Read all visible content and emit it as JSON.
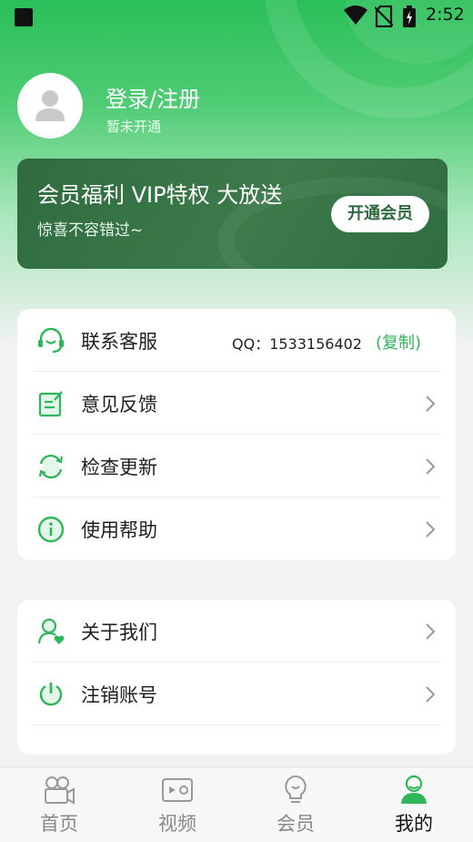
{
  "status": {
    "time": "2:52"
  },
  "profile": {
    "login_label": "登录/注册",
    "status_text": "暂未开通"
  },
  "vip_banner": {
    "title": "会员福利 VIP特权 大放送",
    "subtitle": "惊喜不容错过~",
    "button": "开通会员"
  },
  "menu": {
    "customer_service": {
      "label": "联系客服",
      "qq": "QQ：1533156402",
      "copy": "(复制)"
    },
    "feedback": {
      "label": "意见反馈"
    },
    "update": {
      "label": "检查更新"
    },
    "help": {
      "label": "使用帮助"
    },
    "about": {
      "label": "关于我们"
    },
    "logout": {
      "label": "注销账号"
    }
  },
  "nav": [
    {
      "label": "首页",
      "icon": "video-camera-icon"
    },
    {
      "label": "视频",
      "icon": "video-player-icon"
    },
    {
      "label": "会员",
      "icon": "lightbulb-icon"
    },
    {
      "label": "我的",
      "icon": "user-icon"
    }
  ],
  "colors": {
    "accent": "#2fb55a",
    "banner": "#3c7a4b"
  }
}
